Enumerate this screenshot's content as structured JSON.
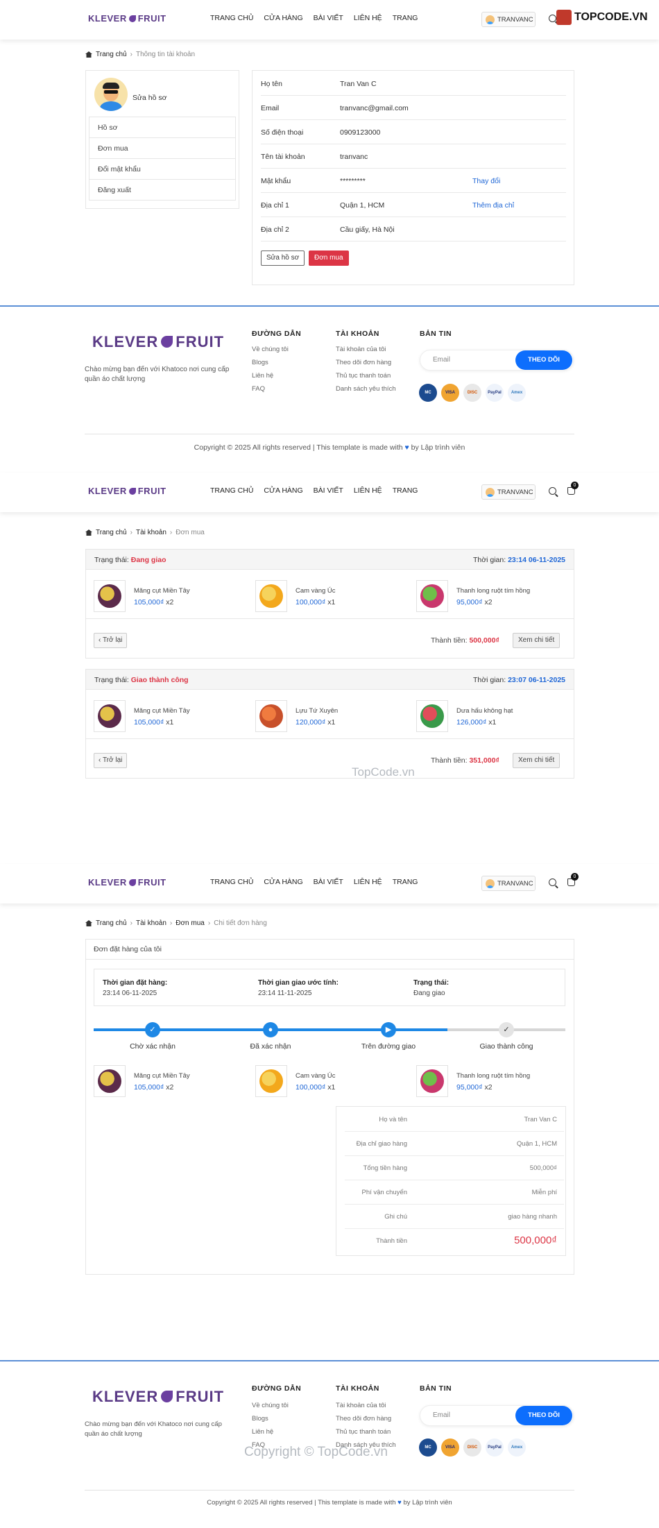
{
  "brand": {
    "logo_left": "KLEVER",
    "logo_right": "FRUIT",
    "watermark_logo": "TOPCODE.VN",
    "watermark_text": "TopCode.vn",
    "watermark_copy": "Copyright © TopCode.vn"
  },
  "nav": [
    "TRANG CHỦ",
    "CỬA HÀNG",
    "BÀI VIẾT",
    "LIÊN HỆ",
    "TRANG"
  ],
  "user": {
    "name": "TRANVANC",
    "cart_count": "0",
    "edit_profile": "Sửa hồ sơ"
  },
  "profile_page": {
    "breadcrumb": [
      "Trang chủ",
      "Thông tin tài khoản"
    ],
    "menu": [
      "Hồ sơ",
      "Đơn mua",
      "Đổi mật khẩu",
      "Đăng xuất"
    ],
    "rows": [
      {
        "label": "Họ tên",
        "value": "Tran Van C",
        "action": ""
      },
      {
        "label": "Email",
        "value": "tranvanc@gmail.com",
        "action": ""
      },
      {
        "label": "Số điện thoại",
        "value": "0909123000",
        "action": ""
      },
      {
        "label": "Tên tài khoản",
        "value": "tranvanc",
        "action": ""
      },
      {
        "label": "Mật khẩu",
        "value": "*********",
        "action": "Thay đổi"
      },
      {
        "label": "Địa chỉ 1",
        "value": "Quận 1, HCM",
        "action": "Thêm địa chỉ"
      },
      {
        "label": "Địa chỉ 2",
        "value": "Cầu giấy, Hà Nội",
        "action": ""
      }
    ],
    "btn_edit": "Sửa hồ sơ",
    "btn_orders": "Đơn mua"
  },
  "footer": {
    "desc1": "Chào mừng bạn đến với Khatoco nơi cung cấp quần áo chất lượng",
    "col1_title": "ĐƯỜNG DẪN",
    "col1": [
      "Về chúng tôi",
      "Blogs",
      "Liên hệ",
      "FAQ"
    ],
    "col2_title": "TÀI KHOẢN",
    "col2": [
      "Tài khoản của tôi",
      "Theo dõi đơn hàng",
      "Thủ tục thanh toán",
      "Danh sách yêu thích"
    ],
    "col3_title": "BẢN TIN",
    "email_placeholder": "Email",
    "subscribe": "THEO DÕI",
    "payments": [
      "MC",
      "VISA",
      "DISC",
      "PayPal",
      "Amex"
    ],
    "copyright_a": "Copyright © 2025 All rights reserved | This template is made with",
    "copyright_b": "by",
    "copyright_link": "Lập trình viên"
  },
  "orders_page": {
    "breadcrumb": [
      "Trang chủ",
      "Tài khoản",
      "Đơn mua"
    ],
    "status_label": "Trạng thái:",
    "time_label": "Thời gian:",
    "total_label": "Thành tiền:",
    "back": "Trở lại",
    "detail": "Xem chi tiết",
    "orders": [
      {
        "status": "Đang giao",
        "time": "23:14 06-11-2025",
        "total": "500,000₫",
        "items": [
          {
            "name": "Măng cụt Miền Tây",
            "price": "105,000₫",
            "qty": "x2"
          },
          {
            "name": "Cam vàng Úc",
            "price": "100,000₫",
            "qty": "x1"
          },
          {
            "name": "Thanh long ruột tím hồng",
            "price": "95,000₫",
            "qty": "x2"
          }
        ]
      },
      {
        "status": "Giao thành công",
        "time": "23:07 06-11-2025",
        "total": "351,000₫",
        "items": [
          {
            "name": "Măng cụt Miền Tây",
            "price": "105,000₫",
            "qty": "x1"
          },
          {
            "name": "Lựu Tứ Xuyên",
            "price": "120,000₫",
            "qty": "x1"
          },
          {
            "name": "Dưa hấu không hạt",
            "price": "126,000₫",
            "qty": "x1"
          }
        ]
      }
    ]
  },
  "detail_page": {
    "breadcrumb": [
      "Trang chủ",
      "Tài khoản",
      "Đơn mua",
      "Chi tiết đơn hàng"
    ],
    "title": "Đơn đặt hàng của tôi",
    "order_time_label": "Thời gian đặt hàng:",
    "order_time": "23:14 06-11-2025",
    "eta_label": "Thời gian giao ước tính:",
    "eta": "23:14 11-11-2025",
    "status_label": "Trạng thái:",
    "status": "Đang giao",
    "steps": [
      "Chờ xác nhận",
      "Đã xác nhận",
      "Trên đường giao",
      "Giao thành công"
    ],
    "progress": 0.75,
    "items": [
      {
        "name": "Măng cụt Miền Tây",
        "price": "105,000₫",
        "qty": "x2"
      },
      {
        "name": "Cam vàng Úc",
        "price": "100,000₫",
        "qty": "x1"
      },
      {
        "name": "Thanh long ruột tím hồng",
        "price": "95,000₫",
        "qty": "x2"
      }
    ],
    "summary": [
      {
        "k": "Họ và tên",
        "v": "Tran Van C"
      },
      {
        "k": "Địa chỉ giao hàng",
        "v": "Quận 1, HCM"
      },
      {
        "k": "Tổng tiền hàng",
        "v": "500,000₫"
      },
      {
        "k": "Phí vận chuyển",
        "v": "Miễn phí"
      },
      {
        "k": "Ghi chú",
        "v": "giao hàng nhanh"
      },
      {
        "k": "Thành tiền",
        "v": "500,000₫"
      }
    ]
  },
  "colors": {
    "accent": "#1e66d6",
    "danger": "#dc3545",
    "brand": "#5a3a86"
  }
}
